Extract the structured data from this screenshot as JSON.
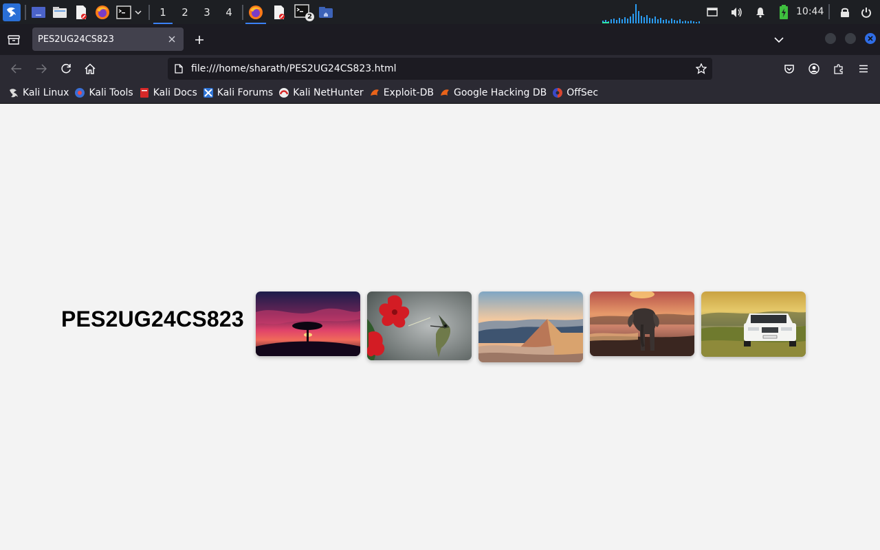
{
  "panel": {
    "workspaces": [
      "1",
      "2",
      "3",
      "4"
    ],
    "active_workspace": "1",
    "terminal_badge": "2",
    "clock": "10:44"
  },
  "browser": {
    "tab_title": "PES2UG24CS823",
    "url": "file:///home/sharath/PES2UG24CS823.html",
    "bookmarks": [
      {
        "label": "Kali Linux",
        "icon": "kali-dragon-icon"
      },
      {
        "label": "Kali Tools",
        "icon": "kali-tools-icon"
      },
      {
        "label": "Kali Docs",
        "icon": "kali-docs-icon"
      },
      {
        "label": "Kali Forums",
        "icon": "kali-forums-icon"
      },
      {
        "label": "Kali NetHunter",
        "icon": "kali-nethunter-icon"
      },
      {
        "label": "Exploit-DB",
        "icon": "exploit-db-icon"
      },
      {
        "label": "Google Hacking DB",
        "icon": "ghdb-icon"
      },
      {
        "label": "OffSec",
        "icon": "offsec-icon"
      }
    ]
  },
  "page": {
    "heading": "PES2UG24CS823",
    "images": [
      {
        "subject": "sunset-tree"
      },
      {
        "subject": "hibiscus-hummingbird"
      },
      {
        "subject": "mountain-ridge"
      },
      {
        "subject": "elephant"
      },
      {
        "subject": "white-suv"
      }
    ]
  },
  "colors": {
    "panel_bg": "#1d1f23",
    "tabbar_bg": "#1c1b22",
    "toolbar_bg": "#2b2a33",
    "accent": "#3b82f6",
    "page_bg": "#f3f3f3"
  }
}
